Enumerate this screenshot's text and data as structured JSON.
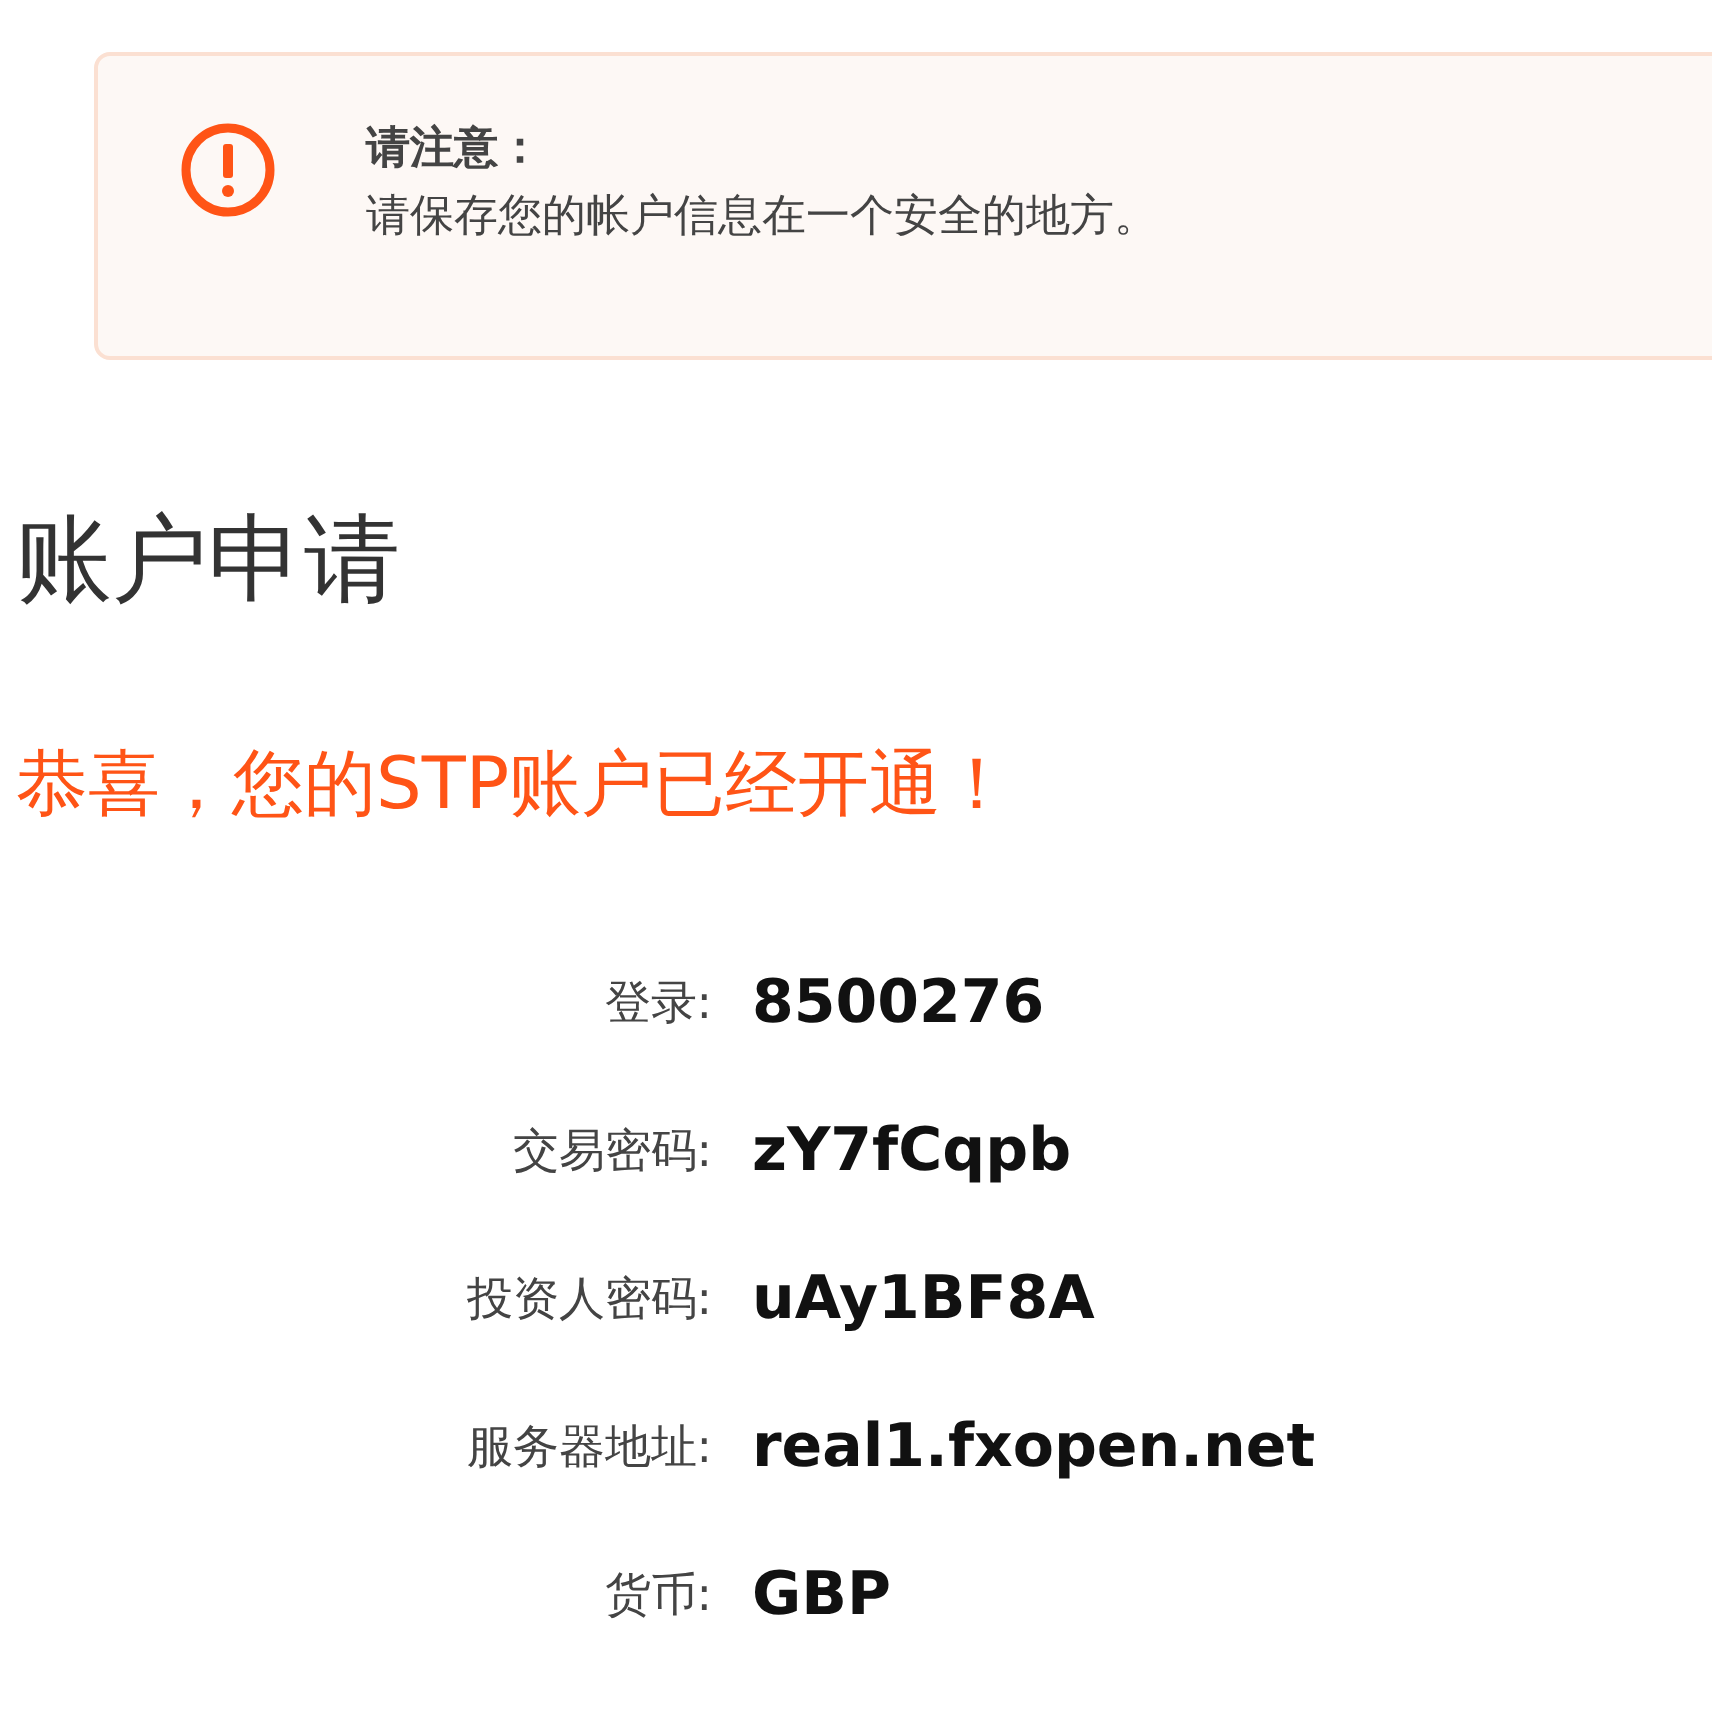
{
  "notice": {
    "title": "请注意：",
    "message": "请保存您的帐户信息在一个安全的地方。"
  },
  "heading": "账户申请",
  "success_message": "恭喜，您的STP账户已经开通！",
  "details": [
    {
      "label": "登录:",
      "value": "8500276"
    },
    {
      "label": "交易密码:",
      "value": "zY7fCqpb"
    },
    {
      "label": "投资人密码:",
      "value": "uAy1BF8A"
    },
    {
      "label": "服务器地址:",
      "value": "real1.fxopen.net"
    },
    {
      "label": "货币:",
      "value": "GBP"
    }
  ]
}
